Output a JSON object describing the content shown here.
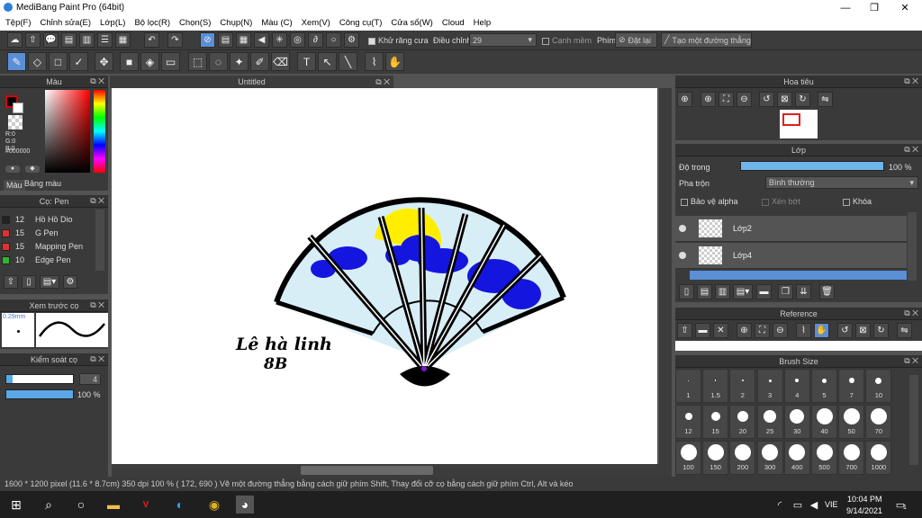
{
  "window": {
    "title": "MediBang Paint Pro (64bit)",
    "min": "—",
    "max": "❐",
    "close": "✕"
  },
  "menu": [
    "Tệp(F)",
    "Chỉnh sửa(E)",
    "Lớp(L)",
    "Bộ lọc(R)",
    "Chọn(S)",
    "Chụp(N)",
    "Màu (C)",
    "Xem(V)",
    "Công cụ(T)",
    "Cửa sổ(W)",
    "Cloud",
    "Help"
  ],
  "toolbar": {
    "antialias_label": "Khử răng cưa",
    "correction_label": "Điều chỉnh",
    "correction_value": "29",
    "edge_label": "Cạnh mềm",
    "key_label": "Phím",
    "reset_label": "Đặt lại",
    "straight_line_label": "Tạo một đường thẳng"
  },
  "color_panel": {
    "title": "Màu",
    "r": "R:0",
    "g": "G:0",
    "b": "B:0",
    "hex": "#000000",
    "tab_color": "Màu",
    "tab_palette": "Bảng màu"
  },
  "pen_panel": {
    "title": "Cọ: Pen",
    "items": [
      {
        "size": "12",
        "name": "Hồ Hồ Dio",
        "color": "#222222"
      },
      {
        "size": "15",
        "name": "G Pen",
        "color": "#e03030"
      },
      {
        "size": "15",
        "name": "Mapping Pen",
        "color": "#e03030"
      },
      {
        "size": "10",
        "name": "Edge Pen",
        "color": "#2fb52f"
      }
    ]
  },
  "preview_panel": {
    "title": "Xem trước cọ",
    "size": "0.29mm"
  },
  "control_panel": {
    "title": "Kiểm soát cọ",
    "size_value": "4",
    "opacity_value": "100 %",
    "size_fill": 0.1,
    "opacity_fill": 1.0
  },
  "canvas": {
    "tab": "Untitled",
    "signature": "Lê hà linh",
    "class": "8B"
  },
  "navigator": {
    "title": "Hoa tiêu"
  },
  "layer_panel": {
    "title": "Lớp",
    "opacity_label": "Độ trong",
    "opacity_value": "100 %",
    "opacity_fill": 1.0,
    "blend_label": "Pha trộn",
    "blend_value": "Bình thường",
    "protect_alpha": "Bảo vệ alpha",
    "clipping": "Xén bớt",
    "lock": "Khóa",
    "layers": [
      "Lớp2",
      "Lớp4"
    ]
  },
  "reference_panel": {
    "title": "Reference"
  },
  "brush_size_panel": {
    "title": "Brush Size",
    "sizes": [
      "1",
      "1.5",
      "2",
      "3",
      "4",
      "5",
      "7",
      "10",
      "12",
      "15",
      "20",
      "25",
      "30",
      "40",
      "50",
      "70",
      "100",
      "150",
      "200",
      "300",
      "400",
      "500",
      "700",
      "1000"
    ]
  },
  "status": {
    "text": "1600 * 1200 pixel  (11.6 * 8.7cm)  350 dpi  100 %  ( 172, 690 )  Vẽ một đường thẳng bằng cách giữ phím Shift, Thay đổi cỡ cọ bằng cách giữ phím Ctrl, Alt và kéo"
  },
  "taskbar": {
    "lang": "VIE",
    "time": "10:04 PM",
    "date": "9/14/2021",
    "notif": "1"
  },
  "colors": {
    "accent": "#5a8fd6",
    "fan_sky": "#d8eef6",
    "cloud": "#1515e0",
    "sun": "#ffee00"
  }
}
